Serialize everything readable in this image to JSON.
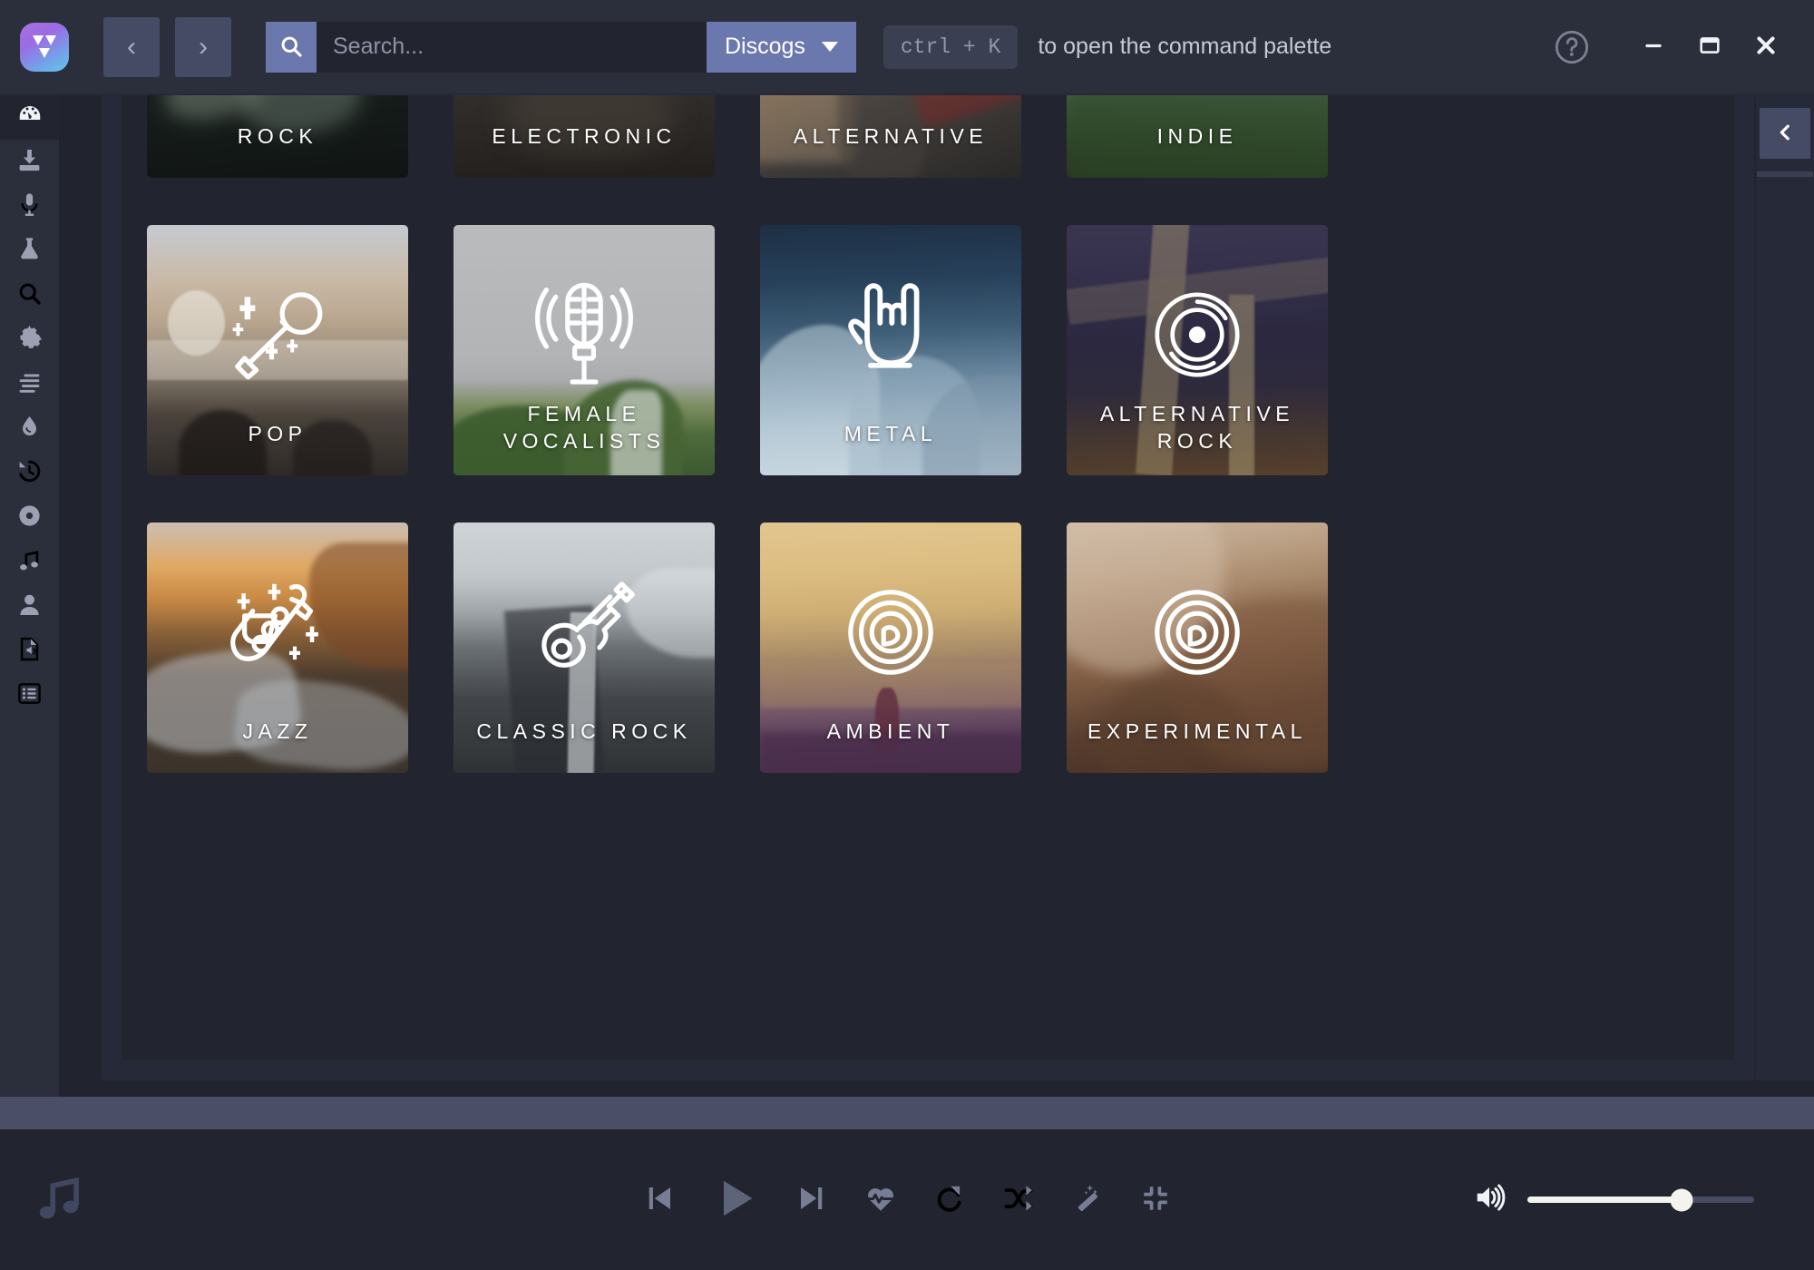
{
  "titlebar": {
    "logo_icon": "app-logo-icon",
    "nav_back_label": "‹",
    "nav_forward_label": "›",
    "search_icon": "search-icon",
    "search_value": "",
    "search_placeholder": "Search...",
    "source_label": "Discogs",
    "source_caret_icon": "chevron-down-icon",
    "kbd_shortcut": "ctrl + K",
    "kbd_hint_text": "to open the command palette",
    "help_icon": "help-circle-icon",
    "minimize_icon": "minimize-icon",
    "maximize_icon": "maximize-icon",
    "close_icon": "close-icon"
  },
  "sidebar": {
    "items": [
      {
        "name": "dashboard",
        "icon": "gauge-icon",
        "active": true
      },
      {
        "name": "downloads",
        "icon": "download-icon",
        "active": false
      },
      {
        "name": "recorder",
        "icon": "microphone-icon",
        "active": false
      },
      {
        "name": "lab",
        "icon": "flask-icon",
        "active": false
      },
      {
        "name": "search",
        "icon": "magnifier-icon",
        "active": false
      },
      {
        "name": "settings",
        "icon": "gear-icon",
        "active": false
      },
      {
        "name": "queue",
        "icon": "list-lines-icon",
        "active": false
      },
      {
        "name": "fluid",
        "icon": "droplet-icon",
        "active": false
      },
      {
        "name": "history",
        "icon": "history-icon",
        "active": false
      },
      {
        "name": "albums",
        "icon": "disc-icon",
        "active": false
      },
      {
        "name": "tracks",
        "icon": "music-note-icon",
        "active": false
      },
      {
        "name": "artists",
        "icon": "person-icon",
        "active": false
      },
      {
        "name": "files",
        "icon": "audio-file-icon",
        "active": false
      },
      {
        "name": "playlists",
        "icon": "playlist-icon",
        "active": false
      }
    ]
  },
  "genres": [
    {
      "label": "Rock",
      "icon": "electric-guitar-icon",
      "bg": "linear-gradient(175deg,#232b29 0%,#1b2220 40%,#101513 100%)",
      "accents": [
        {
          "l": "6%",
          "t": "50%",
          "w": "40%",
          "h": "26%",
          "c": "rgba(196,214,196,0.30)",
          "r": "60% 40% 50% 50%/60% 50% 50% 40%",
          "rot": "-14deg",
          "b": "10px"
        },
        {
          "l": "36%",
          "t": "56%",
          "w": "46%",
          "h": "26%",
          "c": "rgba(186,208,188,0.26)",
          "r": "55% 45% 50% 50%",
          "rot": "-6deg",
          "b": "10px"
        },
        {
          "l": "54%",
          "t": "38%",
          "w": "44%",
          "h": "24%",
          "c": "rgba(176,200,180,0.24)",
          "r": "50% 50% 55% 45%",
          "rot": "10deg",
          "b": "11px"
        }
      ]
    },
    {
      "label": "Electronic",
      "icon": "drum-machine-icon",
      "bg": "linear-gradient(178deg,#c9ccd2 0%,#b2b6bd 27%,#6e6a63 40%,#332f2c 62%,#221f1d 100%)",
      "accents": [
        {
          "l": "30%",
          "t": "0%",
          "w": "16%",
          "h": "42%",
          "c": "rgba(20,20,24,0.85)",
          "r": "6px",
          "rot": "0deg",
          "b": "2px"
        },
        {
          "l": "52%",
          "t": "0%",
          "w": "16%",
          "h": "44%",
          "c": "rgba(20,20,24,0.85)",
          "r": "6px",
          "rot": "0deg",
          "b": "2px"
        },
        {
          "l": "20%",
          "t": "60%",
          "w": "64%",
          "h": "30%",
          "c": "rgba(90,80,70,0.35)",
          "r": "40%",
          "rot": "0deg",
          "b": "14px"
        }
      ]
    },
    {
      "label": "Alternative",
      "icon": "vinyl-record-icon",
      "bg": "linear-gradient(160deg,#b9a893 0%,#9d8c76 25%,#6b5c4c 48%,#3d3a38 72%,#2a2826 100%)",
      "accents": [
        {
          "l": "-4%",
          "t": "8%",
          "w": "40%",
          "h": "86%",
          "c": "rgba(175,150,120,0.40)",
          "r": "8px",
          "rot": "0deg",
          "b": "6px"
        },
        {
          "l": "30%",
          "t": "18%",
          "w": "34%",
          "h": "82%",
          "c": "rgba(70,64,60,0.55)",
          "r": "40% 40% 20% 20%",
          "rot": "0deg",
          "b": "4px"
        },
        {
          "l": "58%",
          "t": "48%",
          "w": "46%",
          "h": "26%",
          "c": "rgba(120,40,38,0.55)",
          "r": "10px",
          "rot": "-18deg",
          "b": "5px"
        }
      ]
    },
    {
      "label": "Indie",
      "icon": "vinyl-record-icon",
      "bg": "linear-gradient(182deg,#aec3d3 0%,#93b2c8 22%,#6f93ad 38%,#4e6d54 58%,#35502f 78%,#24351f 100%)",
      "accents": [
        {
          "l": "46%",
          "t": "0%",
          "w": "30%",
          "h": "52%",
          "c": "rgba(150,170,185,0.45)",
          "r": "3px",
          "rot": "0deg",
          "b": "3px"
        },
        {
          "l": "6%",
          "t": "30%",
          "w": "40%",
          "h": "18%",
          "c": "rgba(120,150,170,0.38)",
          "r": "4px",
          "rot": "0deg",
          "b": "2px"
        },
        {
          "l": "0%",
          "t": "62%",
          "w": "110%",
          "h": "42%",
          "c": "rgba(45,70,40,0.50)",
          "r": "0",
          "rot": "0deg",
          "b": "8px"
        }
      ]
    },
    {
      "label": "Pop",
      "icon": "microphone-sparkle-icon",
      "bg": "linear-gradient(180deg,#c6cbd1 0%,#c9b9a6 22%,#b9a68f 38%,#8f8374 56%,#4a433c 76%,#2e2a28 100%)",
      "accents": [
        {
          "l": "8%",
          "t": "26%",
          "w": "22%",
          "h": "26%",
          "c": "rgba(240,238,232,0.55)",
          "r": "50%",
          "rot": "0deg",
          "b": "1px"
        },
        {
          "l": "0%",
          "t": "46%",
          "w": "100%",
          "h": "16%",
          "c": "rgba(225,218,205,0.40)",
          "r": "2px",
          "rot": "0deg",
          "b": "1px"
        },
        {
          "l": "12%",
          "t": "74%",
          "w": "34%",
          "h": "34%",
          "c": "rgba(25,22,20,0.70)",
          "r": "48% 48% 0 0",
          "rot": "0deg",
          "b": "3px"
        },
        {
          "l": "56%",
          "t": "78%",
          "w": "30%",
          "h": "30%",
          "c": "rgba(30,26,24,0.65)",
          "r": "48% 48% 0 0",
          "rot": "0deg",
          "b": "3px"
        }
      ]
    },
    {
      "label": "Female Vocalists",
      "icon": "retro-microphone-icon",
      "bg": "linear-gradient(180deg,#b9bbbd 0%,#b2b4b6 52%,#a9abad 62%,#7d8f62 72%,#4e6b3c 84%,#3c5930 100%)",
      "accents": [
        {
          "l": "-5%",
          "t": "72%",
          "w": "62%",
          "h": "36%",
          "c": "rgba(60,92,46,0.9)",
          "r": "50% 50% 0 0",
          "rot": "0deg",
          "b": "3px"
        },
        {
          "l": "42%",
          "t": "62%",
          "w": "46%",
          "h": "44%",
          "c": "rgba(70,100,52,0.9)",
          "r": "60% 40% 0 0",
          "rot": "0deg",
          "b": "3px"
        },
        {
          "l": "60%",
          "t": "66%",
          "w": "20%",
          "h": "40%",
          "c": "rgba(225,228,226,0.60)",
          "r": "40% 20% 0 0",
          "rot": "0deg",
          "b": "3px"
        }
      ]
    },
    {
      "label": "Metal",
      "icon": "rock-hand-icon",
      "bg": "linear-gradient(178deg,#1d2f44 0%,#27405a 22%,#3d5c75 42%,#6b8aa2 62%,#9fb6c6 80%,#c3d2dc 100%)",
      "accents": [
        {
          "l": "-6%",
          "t": "40%",
          "w": "52%",
          "h": "62%",
          "c": "rgba(210,224,232,0.48)",
          "r": "60% 40% 0 0",
          "rot": "0deg",
          "b": "2px"
        },
        {
          "l": "34%",
          "t": "52%",
          "w": "50%",
          "h": "52%",
          "c": "rgba(160,182,198,0.50)",
          "r": "50% 50% 0 0",
          "rot": "0deg",
          "b": "2px"
        },
        {
          "l": "62%",
          "t": "60%",
          "w": "46%",
          "h": "46%",
          "c": "rgba(120,145,165,0.45)",
          "r": "60% 30% 0 0",
          "rot": "0deg",
          "b": "2px"
        }
      ]
    },
    {
      "label": "Alternative Rock",
      "icon": "vinyl-record-icon",
      "bg": "linear-gradient(178deg,#3a3550 0%,#332f4a 25%,#2b2840 45%,#2e2a3c 65%,#46372f 85%,#57402c 100%)",
      "accents": [
        {
          "l": "30%",
          "t": "-4%",
          "w": "14%",
          "h": "104%",
          "c": "rgba(168,150,110,0.45)",
          "r": "2px",
          "rot": "4deg",
          "b": "1px"
        },
        {
          "l": "62%",
          "t": "28%",
          "w": "10%",
          "h": "78%",
          "c": "rgba(178,160,118,0.50)",
          "r": "2px",
          "rot": "0deg",
          "b": "1px"
        },
        {
          "l": "0%",
          "t": "18%",
          "w": "120%",
          "h": "14%",
          "c": "rgba(110,100,92,0.45)",
          "r": "2px",
          "rot": "-7deg",
          "b": "1px"
        }
      ]
    },
    {
      "label": "Jazz",
      "icon": "saxophone-icon",
      "bg": "linear-gradient(180deg,#cbbfb1 0%,#e0a863 18%,#c98a45 30%,#8a6138 44%,#4a3a2c 62%,#3b332b 100%)",
      "accents": [
        {
          "l": "-8%",
          "t": "52%",
          "w": "66%",
          "h": "40%",
          "c": "rgba(205,212,218,0.48)",
          "r": "50% 40% 30% 60%",
          "rot": "-8deg",
          "b": "4px"
        },
        {
          "l": "34%",
          "t": "64%",
          "w": "70%",
          "h": "34%",
          "c": "rgba(190,198,206,0.40)",
          "r": "40% 60% 50% 30%",
          "rot": "6deg",
          "b": "4px"
        },
        {
          "l": "62%",
          "t": "8%",
          "w": "46%",
          "h": "50%",
          "c": "rgba(120,70,36,0.55)",
          "r": "30% 0 0 60%",
          "rot": "0deg",
          "b": "3px"
        }
      ]
    },
    {
      "label": "Classic Rock",
      "icon": "guitar-outline-icon",
      "bg": "linear-gradient(180deg,#cfd4d8 0%,#c2c7cb 22%,#9ea4a8 36%,#6b7074 50%,#42464a 70%,#2f3235 100%)",
      "accents": [
        {
          "l": "22%",
          "t": "34%",
          "w": "34%",
          "h": "76%",
          "c": "rgba(40,44,48,0.60)",
          "r": "0 0 0 0",
          "rot": "-4deg",
          "b": "2px"
        },
        {
          "l": "44%",
          "t": "36%",
          "w": "10%",
          "h": "72%",
          "c": "rgba(235,238,240,0.55)",
          "r": "2px",
          "rot": "1deg",
          "b": "1px"
        },
        {
          "l": "66%",
          "t": "18%",
          "w": "46%",
          "h": "36%",
          "c": "rgba(220,226,230,0.50)",
          "r": "40% 0 0 60%",
          "rot": "0deg",
          "b": "3px"
        }
      ]
    },
    {
      "label": "Ambient",
      "icon": "sonar-record-icon",
      "bg": "linear-gradient(178deg,#e2c68f 0%,#dcbd81 20%,#cfae74 36%,#a98d68 52%,#7d5f6b 70%,#553a5a 86%,#47304d 100%)",
      "accents": [
        {
          "l": "0%",
          "t": "56%",
          "w": "120%",
          "h": "18%",
          "c": "rgba(170,140,100,0.40)",
          "r": "2px",
          "rot": "0deg",
          "b": "2px"
        },
        {
          "l": "44%",
          "t": "66%",
          "w": "9%",
          "h": "26%",
          "c": "rgba(95,45,62,0.82)",
          "r": "40% 40% 10% 10%",
          "rot": "0deg",
          "b": "1px"
        },
        {
          "l": "0%",
          "t": "84%",
          "w": "120%",
          "h": "22%",
          "c": "rgba(72,44,74,0.70)",
          "r": "0",
          "rot": "0deg",
          "b": "4px"
        }
      ]
    },
    {
      "label": "Experimental",
      "icon": "sonar-record-icon",
      "bg": "linear-gradient(172deg,#cdb9a4 0%,#b89c80 20%,#9b7a5c 38%,#7d5b42 56%,#5c4031 74%,#3f2c22 100%)",
      "accents": [
        {
          "l": "-10%",
          "t": "-10%",
          "w": "70%",
          "h": "70%",
          "c": "rgba(215,196,176,0.45)",
          "r": "50% 40% 60% 50%",
          "rot": "0deg",
          "b": "8px"
        },
        {
          "l": "40%",
          "t": "30%",
          "w": "80%",
          "h": "70%",
          "c": "rgba(120,84,60,0.50)",
          "r": "60% 40% 40% 60%",
          "rot": "0deg",
          "b": "9px"
        },
        {
          "l": "10%",
          "t": "62%",
          "w": "60%",
          "h": "50%",
          "c": "rgba(90,62,44,0.48)",
          "r": "50%",
          "rot": "0deg",
          "b": "8px"
        }
      ]
    }
  ],
  "right_rail": {
    "toggle_icon": "chevron-left-icon"
  },
  "progress": {
    "percent": 0
  },
  "player": {
    "now_playing_icon": "music-note-icon",
    "controls": [
      {
        "name": "previous-track",
        "icon": "skip-back-icon"
      },
      {
        "name": "play",
        "icon": "play-icon"
      },
      {
        "name": "next-track",
        "icon": "skip-forward-icon"
      },
      {
        "name": "pulse",
        "icon": "heart-pulse-icon"
      },
      {
        "name": "repeat",
        "icon": "repeat-icon"
      },
      {
        "name": "shuffle",
        "icon": "shuffle-icon"
      },
      {
        "name": "magic",
        "icon": "magic-wand-icon"
      },
      {
        "name": "collapse",
        "icon": "collapse-icon"
      }
    ],
    "volume_icon": "volume-high-icon",
    "volume_percent": 68
  },
  "colors": {
    "window_bg": "#21242f",
    "chrome": "#2b2e3b",
    "panel": "#262938",
    "content": "#22252f",
    "accent": "#6b78ae",
    "muted_text": "#9ba0b3",
    "progress_bar": "#4a4f67"
  }
}
